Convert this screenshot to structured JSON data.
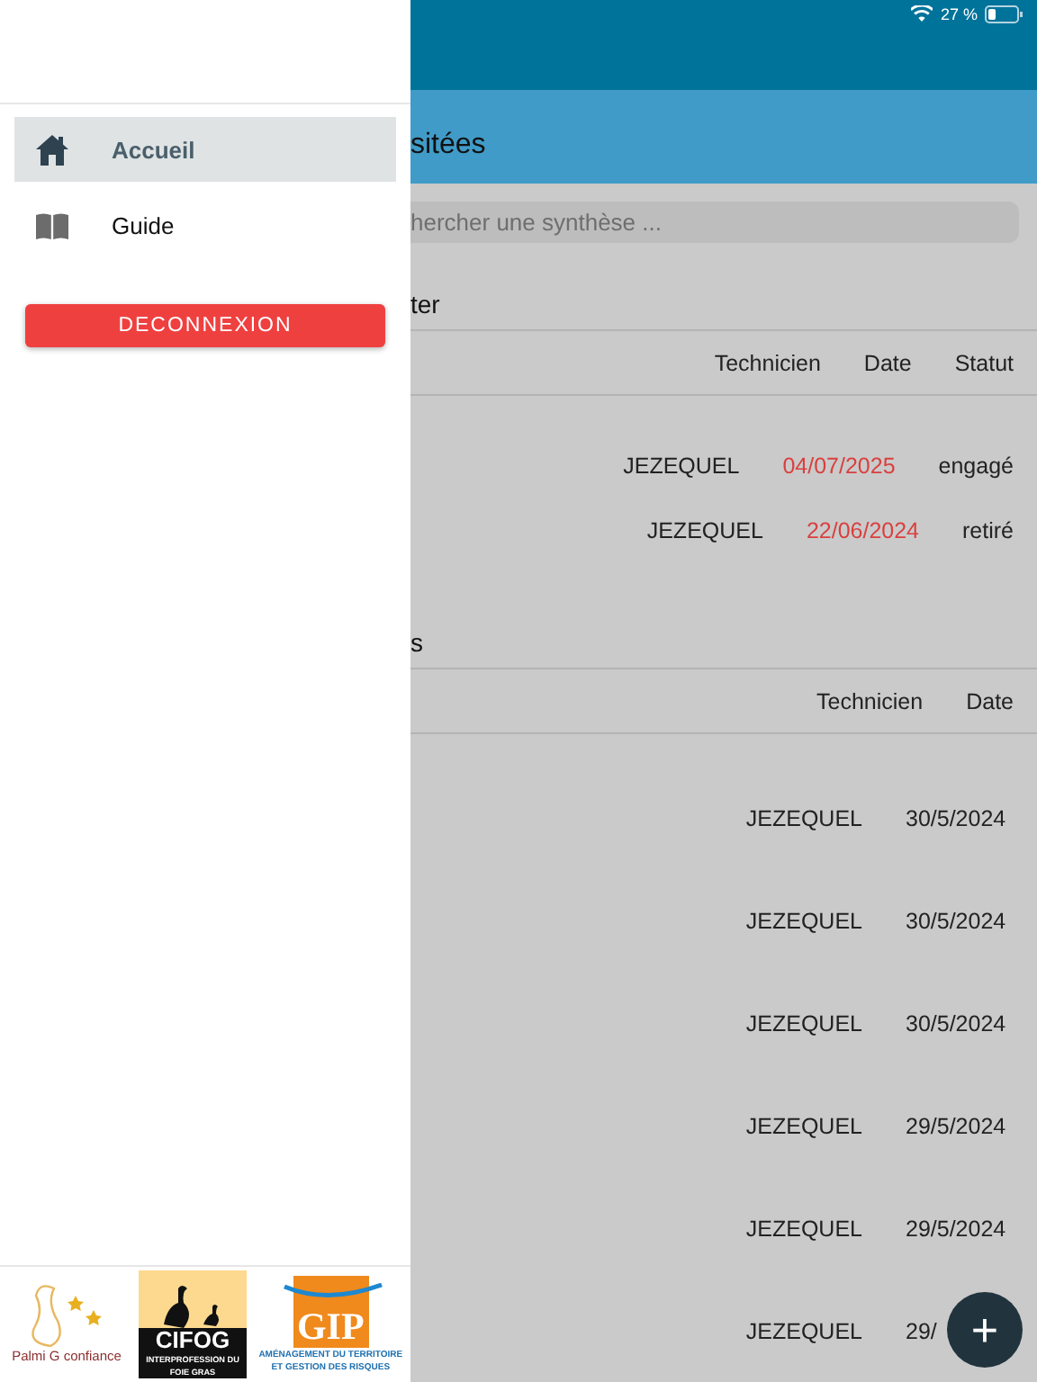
{
  "status_bar": {
    "battery": "27 %"
  },
  "header": {
    "title": "sitées"
  },
  "search": {
    "placeholder": "hercher une synthèse ..."
  },
  "sections": [
    {
      "title": "ter",
      "columns": [
        "Technicien",
        "Date",
        "Statut"
      ],
      "rows": [
        {
          "cells": [
            "JEZEQUEL",
            "04/07/2025",
            "engagé"
          ]
        },
        {
          "cells": [
            "JEZEQUEL",
            "22/06/2024",
            "retiré"
          ]
        }
      ]
    },
    {
      "title": "s",
      "columns": [
        "Technicien",
        "Date"
      ],
      "rows": [
        {
          "cells": [
            "JEZEQUEL",
            "30/5/2024"
          ]
        },
        {
          "cells": [
            "JEZEQUEL",
            "30/5/2024"
          ]
        },
        {
          "cells": [
            "JEZEQUEL",
            "30/5/2024"
          ]
        },
        {
          "cells": [
            "JEZEQUEL",
            "29/5/2024"
          ]
        },
        {
          "cells": [
            "JEZEQUEL",
            "29/5/2024"
          ]
        },
        {
          "cells": [
            "JEZEQUEL",
            "29/"
          ]
        }
      ]
    }
  ],
  "drawer": {
    "items": [
      {
        "label": "Accueil",
        "kind": "home",
        "selected": true
      },
      {
        "label": "Guide",
        "kind": "book",
        "selected": false
      }
    ],
    "logout": "DECONNEXION",
    "logos": [
      {
        "kind": "palmi",
        "texts": [
          "Palmi G confiance"
        ]
      },
      {
        "kind": "cifog",
        "texts": [
          "CIFOG",
          "INTERPROFESSION DU FOIE GRAS"
        ]
      },
      {
        "kind": "gip",
        "texts": [
          "GIP",
          "AMÉNAGEMENT DU TERRITOIRE",
          "ET GESTION DES RISQUES"
        ]
      }
    ]
  },
  "fab": {
    "label": "+"
  }
}
